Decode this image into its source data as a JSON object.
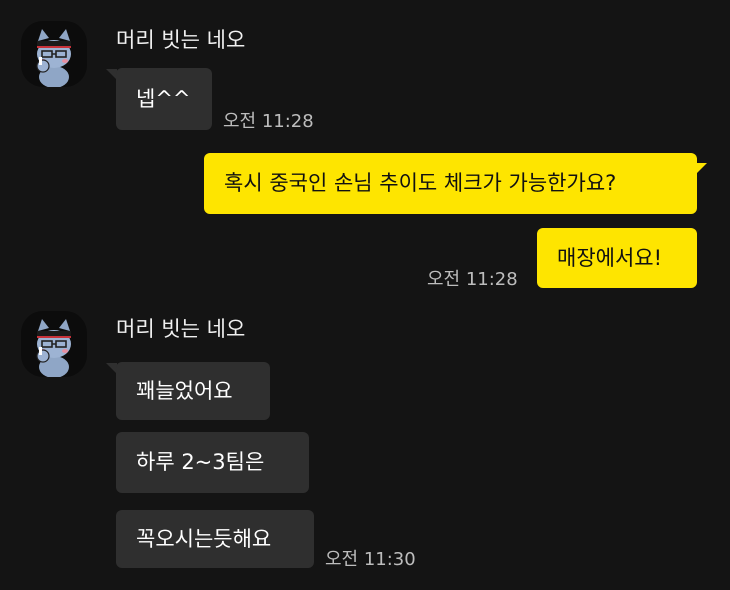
{
  "chat": {
    "messages": [
      {
        "sender": "머리 빗는 네오",
        "avatar_icon": "neo-character-avatar-icon",
        "bubbles": [
          "넵^^"
        ],
        "time": "오전 11:28"
      },
      {
        "sender": "me",
        "bubbles": [
          "혹시 중국인 손님 추이도 체크가 가능한가요?",
          "매장에서요!"
        ],
        "time": "오전 11:28"
      },
      {
        "sender": "머리 빗는 네오",
        "avatar_icon": "neo-character-avatar-icon",
        "bubbles": [
          "꽤늘었어요",
          "하루 2~3팀은",
          "꼭오시는듯해요"
        ],
        "time": "오전 11:30"
      }
    ]
  },
  "colors": {
    "background": "#141414",
    "incoming_bubble": "#2f2f2f",
    "outgoing_bubble": "#fee500",
    "timestamp": "#bdbdbd"
  }
}
